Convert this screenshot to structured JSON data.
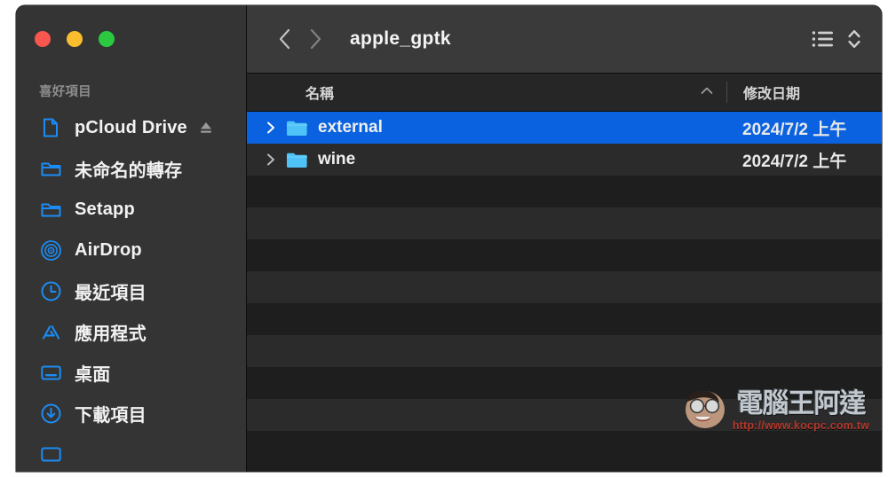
{
  "window": {
    "title": "apple_gptk",
    "traffic_lights": [
      {
        "name": "close",
        "color": "#f9564f"
      },
      {
        "name": "minimize",
        "color": "#f9bd2e"
      },
      {
        "name": "maximize",
        "color": "#2bc940"
      }
    ]
  },
  "toolbar": {
    "back_icon": "chevron-left-icon",
    "forward_icon": "chevron-right-icon",
    "view_icon": "list-view-icon",
    "stepper_icon": "chevron-up-down-icon"
  },
  "sidebar": {
    "section_title": "喜好項目",
    "items": [
      {
        "label": "pCloud Drive",
        "icon": "document-icon",
        "eject": true
      },
      {
        "label": "未命名的轉存",
        "icon": "folder-icon",
        "eject": false
      },
      {
        "label": "Setapp",
        "icon": "folder-icon",
        "eject": false
      },
      {
        "label": "AirDrop",
        "icon": "airdrop-icon",
        "eject": false
      },
      {
        "label": "最近項目",
        "icon": "clock-icon",
        "eject": false
      },
      {
        "label": "應用程式",
        "icon": "appstore-icon",
        "eject": false
      },
      {
        "label": "桌面",
        "icon": "desktop-icon",
        "eject": false
      },
      {
        "label": "下載項目",
        "icon": "download-icon",
        "eject": false
      }
    ]
  },
  "columns": {
    "name": "名稱",
    "date_modified": "修改日期",
    "sort_direction": "ascending",
    "sort_icon": "chevron-up-icon"
  },
  "files": [
    {
      "name": "external",
      "date": "2024/7/2 上午",
      "selected": true,
      "icon": "folder-icon",
      "disclosure": "chevron-right-icon"
    },
    {
      "name": "wine",
      "date": "2024/7/2 上午",
      "selected": false,
      "icon": "folder-icon",
      "disclosure": "chevron-right-icon"
    }
  ],
  "empty_row_count": 9,
  "watermark": {
    "title": "電腦王阿達",
    "url": "http://www.kocpc.com.tw"
  },
  "colors": {
    "selection_blue": "#0a62e0",
    "accent_blue": "#1b8cf5",
    "sidebar_bg": "#343434",
    "toolbar_bg": "#3a3a3a",
    "list_bg_dark": "#1e1e1e",
    "list_bg_light": "#2b2b2b",
    "folder_blue": "#4fc3f7"
  }
}
